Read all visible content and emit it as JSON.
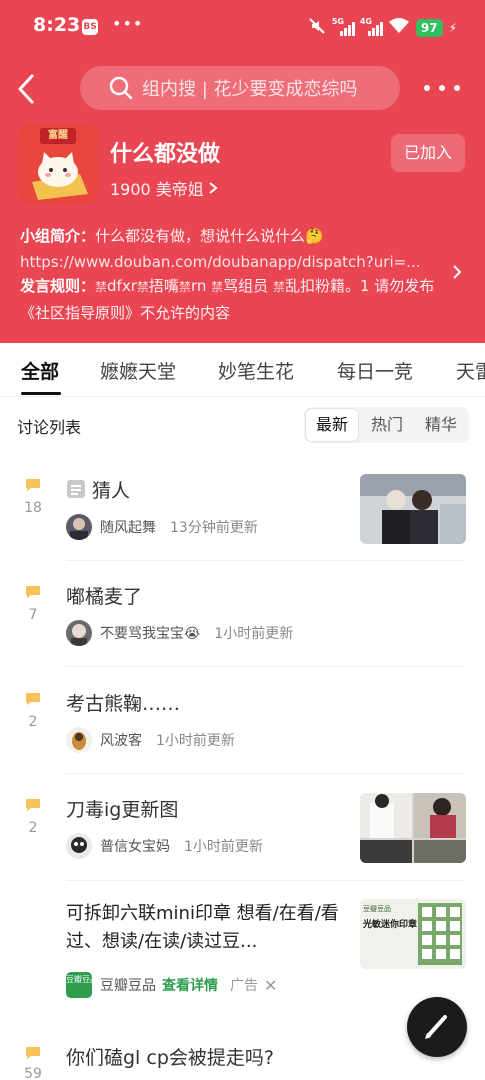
{
  "status_bar": {
    "time": "8:23",
    "app_icon_label": "BS",
    "dots": "•••",
    "signal_1": "5G",
    "signal_2": "4G",
    "battery": "97",
    "colors": {
      "battery": "#2ec15e"
    }
  },
  "header": {
    "background": "#ea4553",
    "search_placeholder": "组内搜 | 花少要变成恋综吗",
    "icons": {
      "back": "back-arrow-icon",
      "search": "search-icon",
      "more": "more-icon"
    }
  },
  "group": {
    "avatar_stamp": "富醒",
    "name": "什么都没做",
    "members": "1900 美帝姐",
    "join_status": "已加入",
    "intro_label": "小组简介：",
    "intro_text": "什么都没有做，想说什么说什么🤔",
    "intro_url": "https://www.douban.com/doubanapp/dispatch?uri=...",
    "rules_label": "发言规则：",
    "rules_text_1": "dfxr",
    "rules_text_2": "捂嘴",
    "rules_text_3": "rn",
    "rules_text_4": "骂组员",
    "rules_text_5": "乱扣粉籍。1 请勿发布《社区指导原则》不允许的内容",
    "ban_glyph": "禁"
  },
  "tabs": [
    "全部",
    "嬷嬷天堂",
    "妙笔生花",
    "每日一竞",
    "天雷"
  ],
  "active_tab": "全部",
  "list": {
    "title": "讨论列表",
    "sort_options": [
      "最新",
      "热门",
      "精华"
    ],
    "active_sort": "最新"
  },
  "topics": [
    {
      "count": "18",
      "title": "猜人",
      "author": "随风起舞",
      "updated": "13分钟前更新",
      "has_doc_icon": true,
      "has_thumb": true
    },
    {
      "count": "7",
      "title": "嘟橘麦了",
      "author": "不要骂我宝宝😭",
      "updated": "1小时前更新",
      "has_thumb": false
    },
    {
      "count": "2",
      "title": "考古熊鞠……",
      "author": "风波客",
      "updated": "1小时前更新",
      "has_thumb": false
    },
    {
      "count": "2",
      "title": "刀毒ig更新图",
      "author": "普信女宝妈",
      "updated": "1小时前更新",
      "has_thumb": true
    },
    {
      "count": "59",
      "title": "你们磕gl cp会被提走吗?",
      "author": "",
      "updated": "",
      "has_thumb": false
    }
  ],
  "ad": {
    "title": "可拆卸六联mini印章 想看/在看/看过、想读/在读/读过豆...",
    "logo_text": "豆瓣豆品",
    "brand": "豆瓣豆品",
    "link": "查看详情",
    "tag": "广告",
    "close": "✕",
    "thumb_text_1": "光敏迷你印章",
    "thumb_text_2": "豆瓣豆品",
    "colors": {
      "brand_green": "#2e9d4e"
    }
  },
  "fab": {
    "icon": "pen-icon"
  }
}
